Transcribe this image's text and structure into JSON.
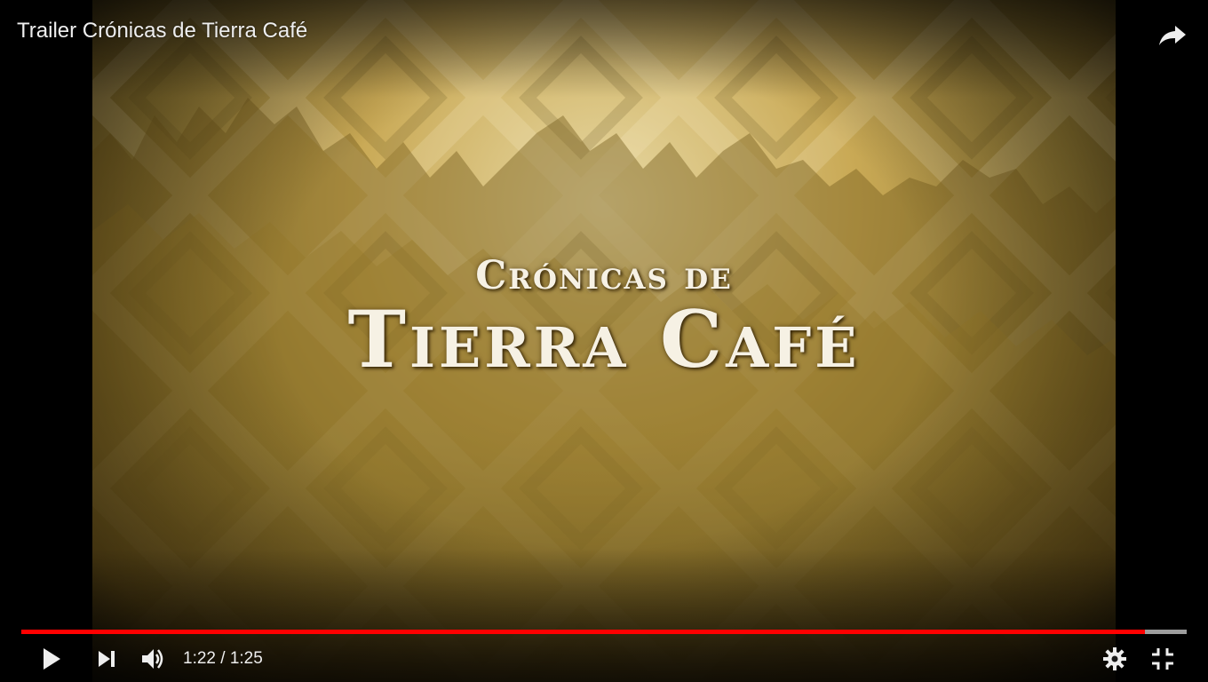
{
  "video": {
    "title": "Trailer Crónicas de Tierra Café",
    "title_art_line1": "Crónicas de",
    "title_art_line2": "Tierra Café"
  },
  "controls": {
    "current_time": "1:22",
    "separator": " / ",
    "duration": "1:25",
    "play_icon": "play-icon",
    "next_icon": "next-icon",
    "volume_icon": "volume-icon",
    "settings_icon": "gear-icon",
    "fullscreen_icon": "exit-fullscreen-icon",
    "share_icon": "share-icon"
  },
  "progress": {
    "played_fraction": 0.964,
    "loaded_fraction": 1.0
  },
  "colors": {
    "progress_played": "#ff0000",
    "icon": "#eeeeee"
  }
}
